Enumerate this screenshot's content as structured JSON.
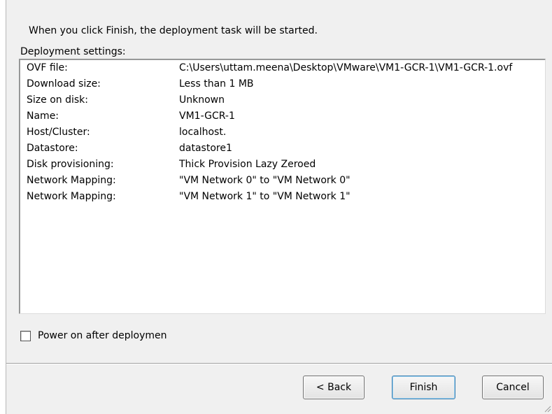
{
  "intro_text": "When you click Finish, the deployment task will be started.",
  "settings_label": "Deployment settings:",
  "settings": [
    {
      "key": "OVF file:",
      "value": "C:\\Users\\uttam.meena\\Desktop\\VMware\\VM1-GCR-1\\VM1-GCR-1.ovf"
    },
    {
      "key": "Download size:",
      "value": "Less than 1 MB"
    },
    {
      "key": "Size on disk:",
      "value": "Unknown"
    },
    {
      "key": "Name:",
      "value": "VM1-GCR-1"
    },
    {
      "key": "Host/Cluster:",
      "value": "localhost."
    },
    {
      "key": "Datastore:",
      "value": "datastore1"
    },
    {
      "key": "Disk provisioning:",
      "value": "Thick Provision Lazy Zeroed"
    },
    {
      "key": "Network Mapping:",
      "value": "\"VM Network 0\" to \"VM Network 0\""
    },
    {
      "key": "Network Mapping:",
      "value": "\"VM Network 1\" to \"VM Network 1\""
    }
  ],
  "power_on_label": "Power on after deploymen",
  "power_on_checked": false,
  "buttons": {
    "back": "< Back",
    "finish": "Finish",
    "cancel": "Cancel"
  }
}
